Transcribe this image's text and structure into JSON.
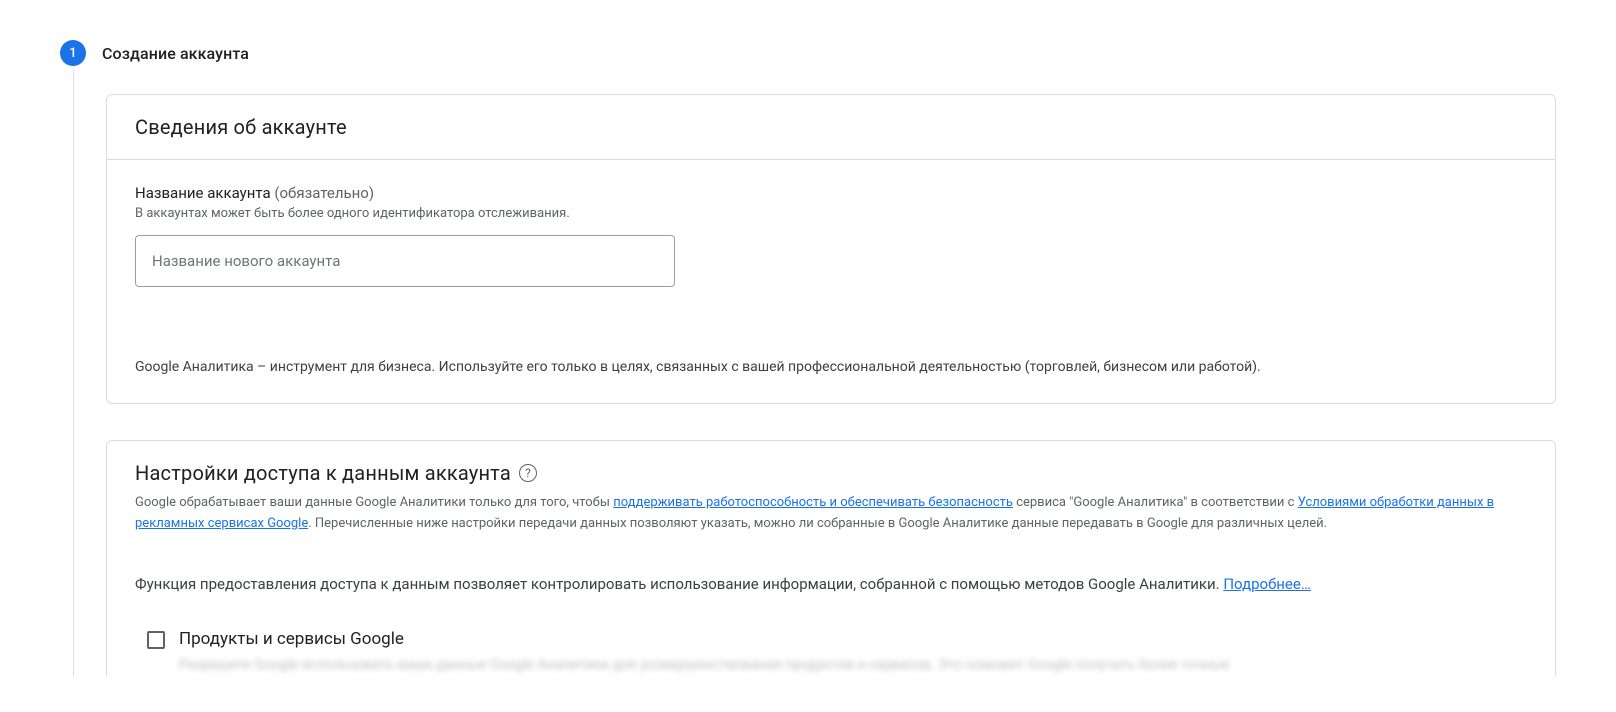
{
  "step": {
    "number": "1",
    "title": "Создание аккаунта"
  },
  "card_account": {
    "header": "Сведения об аккаунте",
    "name_label": "Название аккаунта",
    "name_required": "(обязательно)",
    "name_hint": "В аккаунтах может быть более одного идентификатора отслеживания.",
    "name_placeholder": "Название нового аккаунта",
    "business_note": "Google Аналитика – инструмент для бизнеса. Используйте его только в целях, связанных с вашей профессиональной деятельностью (торговлей, бизнесом или работой)."
  },
  "card_data": {
    "title": "Настройки доступа к данным аккаунта",
    "desc_before_link1": "Google обрабатывает ваши данные Google Аналитики только для того, чтобы ",
    "link1": "поддерживать работоспособность и обеспечивать безопасность",
    "desc_mid1": " сервиса \"Google Аналитика\" в соответствии с ",
    "link2": "Условиями обработки данных в рекламных сервисах Google",
    "desc_after": ". Перечисленные ниже настройки передачи данных позволяют указать, можно ли собранные в Google Аналитике данные передавать в Google для различных целей.",
    "func_text": "Функция предоставления доступа к данным позволяет контролировать использование информации, собранной с помощью методов Google Аналитики. ",
    "func_link": "Подробнее…",
    "checkbox1_label": "Продукты и сервисы Google",
    "checkbox1_desc": "Разрешите Google использовать ваши данные Google Аналитики для усовершенствования продуктов и сервисов. Это поможет Google получать более точные"
  }
}
